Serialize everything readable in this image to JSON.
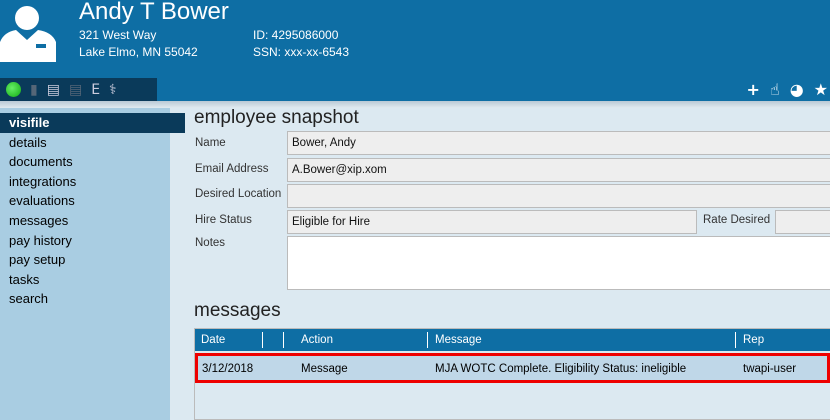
{
  "employee": {
    "name": "Andy T Bower",
    "address1": "321 West Way",
    "address2": "Lake Elmo, MN 55042",
    "id": "ID: 4295086000",
    "ssn": "SSN: xxx-xx-6543"
  },
  "toolbar_left": [
    {
      "icon": "status-green-dot-icon"
    },
    {
      "icon": "document-icon"
    },
    {
      "icon": "id-card-icon"
    },
    {
      "icon": "id-card-dim-icon"
    },
    {
      "icon": "e-verify-icon",
      "label": "E"
    },
    {
      "icon": "caduceus-icon"
    }
  ],
  "toolbar_right": [
    {
      "icon": "plus-icon",
      "glyph": "+"
    },
    {
      "icon": "hand-pointer-icon",
      "glyph": "☝"
    },
    {
      "icon": "pie-chart-icon",
      "glyph": "◕"
    },
    {
      "icon": "star-icon",
      "glyph": "★"
    }
  ],
  "sidebar": {
    "items": [
      {
        "label": "visifile"
      },
      {
        "label": "details"
      },
      {
        "label": "documents"
      },
      {
        "label": "integrations"
      },
      {
        "label": "evaluations"
      },
      {
        "label": "messages"
      },
      {
        "label": "pay history"
      },
      {
        "label": "pay setup"
      },
      {
        "label": "tasks"
      },
      {
        "label": "search"
      }
    ]
  },
  "snapshot": {
    "title": "employee snapshot",
    "name_label": "Name",
    "name_value": "Bower, Andy",
    "email_label": "Email Address",
    "email_value": "A.Bower@xip.xom",
    "location_label": "Desired Location",
    "location_value": "",
    "hire_label": "Hire Status",
    "hire_value": "Eligible for Hire",
    "rate_label": "Rate Desired",
    "rate_value": "",
    "notes_label": "Notes",
    "notes_value": ""
  },
  "messages": {
    "title": "messages",
    "columns": [
      "Date",
      "Action",
      "Message",
      "Rep"
    ],
    "rows": [
      {
        "date": "3/12/2018",
        "action": "Message",
        "message": "MJA WOTC Complete. Eligibility Status: ineligible",
        "rep": "twapi-user"
      }
    ]
  },
  "colors": {
    "header": "#0e6ea4",
    "navy": "#0a3a5a",
    "sidebar": "#a9cde2",
    "highlight": "#ee0000"
  }
}
